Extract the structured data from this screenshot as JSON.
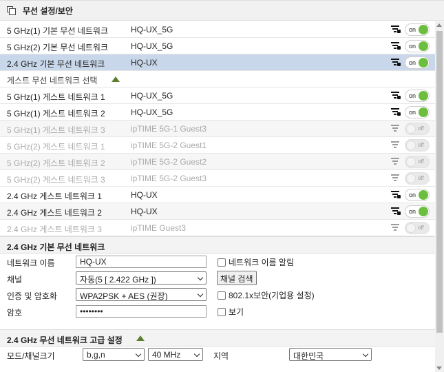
{
  "header": {
    "title": "무선 설정/보안"
  },
  "networks": [
    {
      "name": "5 GHz(1) 기본 무선 네트워크",
      "ssid": "HQ-UX_5G",
      "toggle": "on",
      "enabled": true,
      "selected": false
    },
    {
      "name": "5 GHz(2) 기본 무선 네트워크",
      "ssid": "HQ-UX_5G",
      "toggle": "on",
      "enabled": true,
      "selected": false
    },
    {
      "name": "2.4 GHz 기본 무선 네트워크",
      "ssid": "HQ-UX",
      "toggle": "on",
      "enabled": true,
      "selected": true
    }
  ],
  "guest_section": {
    "label": "게스트 무선 네트워크 선택"
  },
  "guests": [
    {
      "name": "5 GHz(1) 게스트 네트워크 1",
      "ssid": "HQ-UX_5G",
      "toggle": "on",
      "enabled": true
    },
    {
      "name": "5 GHz(1) 게스트 네트워크 2",
      "ssid": "HQ-UX_5G",
      "toggle": "on",
      "enabled": true
    },
    {
      "name": "5 GHz(1) 게스트 네트워크 3",
      "ssid": "ipTIME 5G-1 Guest3",
      "toggle": "off",
      "enabled": false
    },
    {
      "name": "5 GHz(2) 게스트 네트워크 1",
      "ssid": "ipTIME 5G-2 Guest1",
      "toggle": "off",
      "enabled": false
    },
    {
      "name": "5 GHz(2) 게스트 네트워크 2",
      "ssid": "ipTIME 5G-2 Guest2",
      "toggle": "off",
      "enabled": false
    },
    {
      "name": "5 GHz(2) 게스트 네트워크 3",
      "ssid": "ipTIME 5G-2 Guest3",
      "toggle": "off",
      "enabled": false
    },
    {
      "name": "2.4 GHz 게스트 네트워크 1",
      "ssid": "HQ-UX",
      "toggle": "on",
      "enabled": true
    },
    {
      "name": "2.4 GHz 게스트 네트워크 2",
      "ssid": "HQ-UX",
      "toggle": "on",
      "enabled": true
    },
    {
      "name": "2.4 GHz 게스트 네트워크 3",
      "ssid": "ipTIME Guest3",
      "toggle": "off",
      "enabled": false
    }
  ],
  "basic": {
    "title": "2.4 GHz 기본 무선 네트워크",
    "network_name_label": "네트워크 이름",
    "network_name_value": "HQ-UX",
    "broadcast_label": "네트워크 이름 알림",
    "channel_label": "채널",
    "channel_value": "자동(5 [ 2.422 GHz ])",
    "channel_search_label": "채널 검색",
    "auth_label": "인증 및 암호화",
    "auth_value": "WPA2PSK + AES (권장)",
    "enterprise_label": "802.1x보안(기업용 설정)",
    "password_label": "암호",
    "password_value": "••••••••",
    "show_label": "보기"
  },
  "advanced": {
    "title": "2.4 GHz 무선 네트워크 고급 설정",
    "mode_label": "모드/채널크기",
    "mode_value": "b,g,n",
    "width_value": "40 MHz",
    "region_label": "지역",
    "region_value": "대한민국"
  },
  "colors": {
    "toggle_on": "#6cbf3e",
    "selected_row": "#c9d7ea",
    "section_arrow": "#5d7d2e"
  }
}
